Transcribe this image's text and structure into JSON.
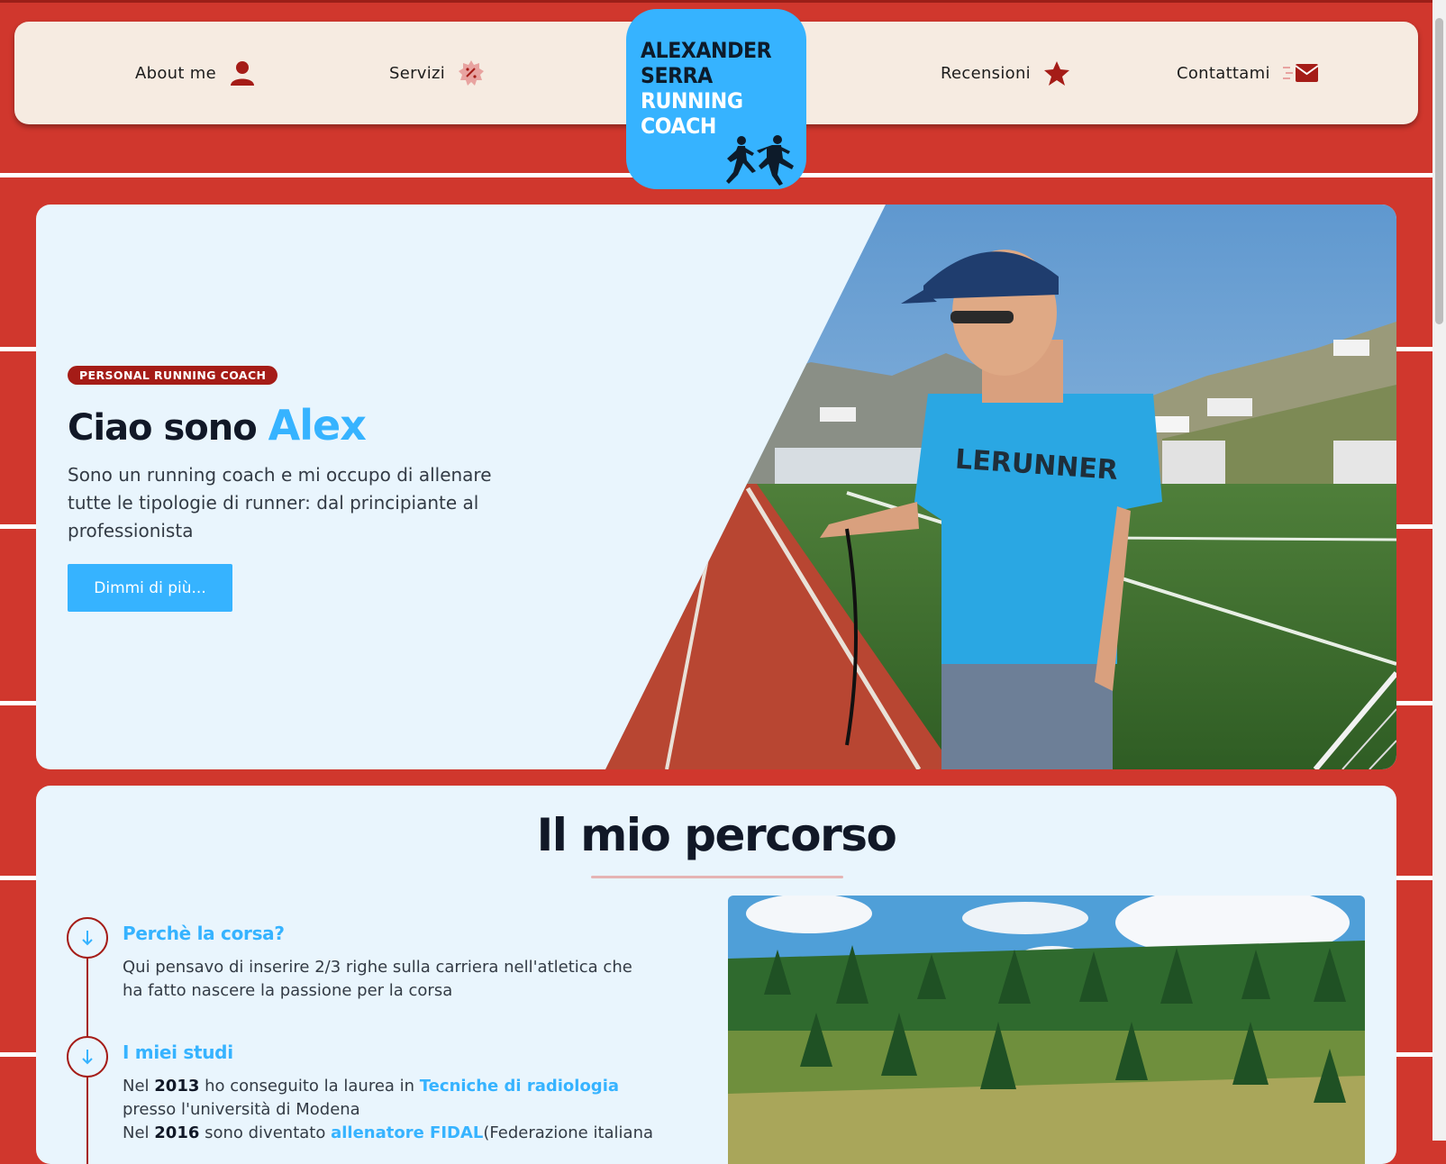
{
  "nav": {
    "about_label": "About me",
    "servizi_label": "Servizi",
    "recensioni_label": "Recensioni",
    "contatti_label": "Contattami",
    "icons": [
      "user-icon",
      "badge-icon",
      "star-icon",
      "mail-icon"
    ]
  },
  "logo": {
    "line1": "ALEXANDER",
    "line2": "SERRA",
    "line3": "RUNNING",
    "line4": "COACH"
  },
  "hero": {
    "badge": "PERSONAL RUNNING COACH",
    "title_prefix": "Ciao sono",
    "title_name": "Alex",
    "description": "Sono un running coach e mi occupo di allenare tutte le tipologie di runner: dal principiante al professionista",
    "button_label": "Dimmi di più...",
    "shirt_text": "LERUNNER"
  },
  "percorso": {
    "title": "Il mio percorso",
    "items": [
      {
        "title": "Perchè la corsa?",
        "text": "Qui pensavo di inserire 2/3 righe sulla carriera nell'atletica che ha fatto nascere la passione per la corsa"
      },
      {
        "title": "I miei studi",
        "p1_a": "Nel ",
        "p1_year": "2013",
        "p1_b": " ho conseguito la laurea in ",
        "p1_link": "Tecniche di radiologia",
        "p1_c": " presso l'università di Modena",
        "p2_a": "Nel ",
        "p2_year": "2016",
        "p2_b": " sono diventato ",
        "p2_link": "allenatore FIDAL",
        "p2_c": "(Federazione italiana"
      }
    ]
  },
  "colors": {
    "track_red": "#d0372d",
    "accent_blue": "#36b3ff",
    "badge_red": "#a51c17",
    "panel_bg": "#e9f5fd",
    "nav_bg": "#f6ebe1"
  }
}
